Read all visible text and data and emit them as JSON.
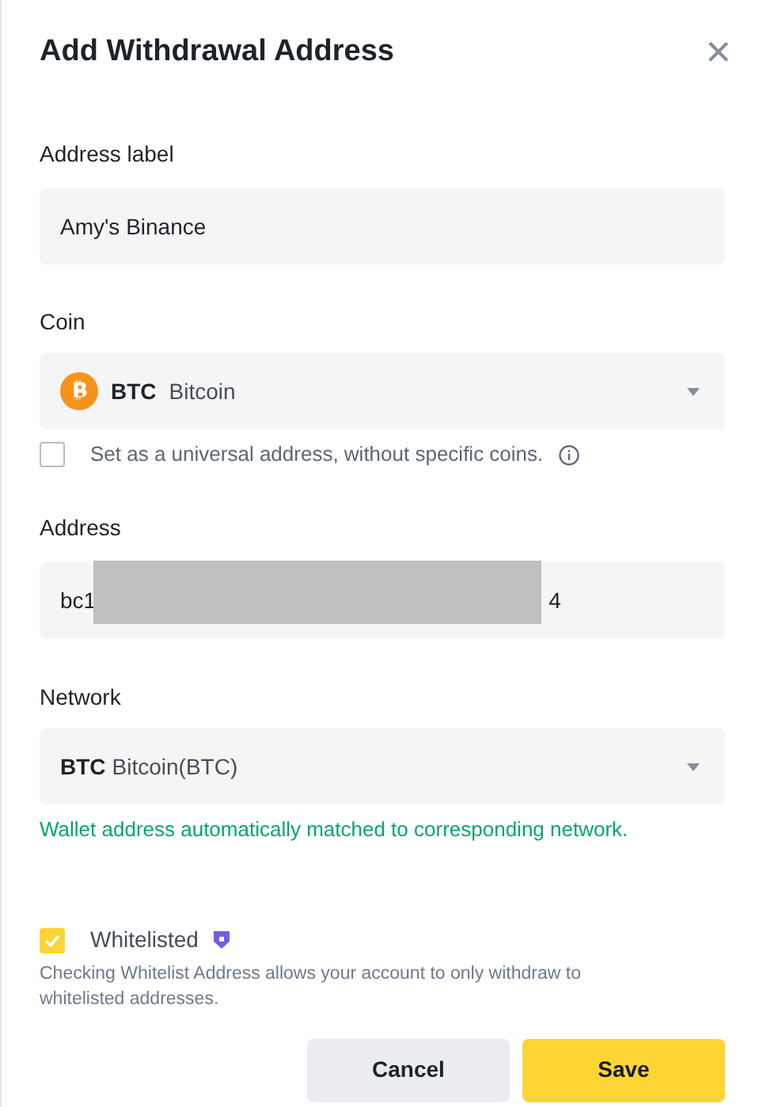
{
  "dialog": {
    "title": "Add Withdrawal Address",
    "close": "×"
  },
  "address_label": {
    "label": "Address label",
    "value": "Amy's Binance"
  },
  "coin": {
    "label": "Coin",
    "symbol": "BTC",
    "name": "Bitcoin"
  },
  "universal": {
    "label": "Set as a universal address, without specific coins.",
    "checked": false
  },
  "address": {
    "label": "Address",
    "value_start": "bc1",
    "value_end": "4",
    "redacted": true
  },
  "network": {
    "label": "Network",
    "symbol": "BTC",
    "name": "Bitcoin(BTC)",
    "hint": "Wallet address automatically matched to corresponding network."
  },
  "whitelist": {
    "label": "Whitelisted",
    "checked": true,
    "description": "Checking Whitelist Address allows your account to only withdraw to whitelisted addresses."
  },
  "buttons": [
    {
      "label": "Cancel",
      "kind": "secondary"
    },
    {
      "label": "Save",
      "kind": "primary"
    }
  ]
}
